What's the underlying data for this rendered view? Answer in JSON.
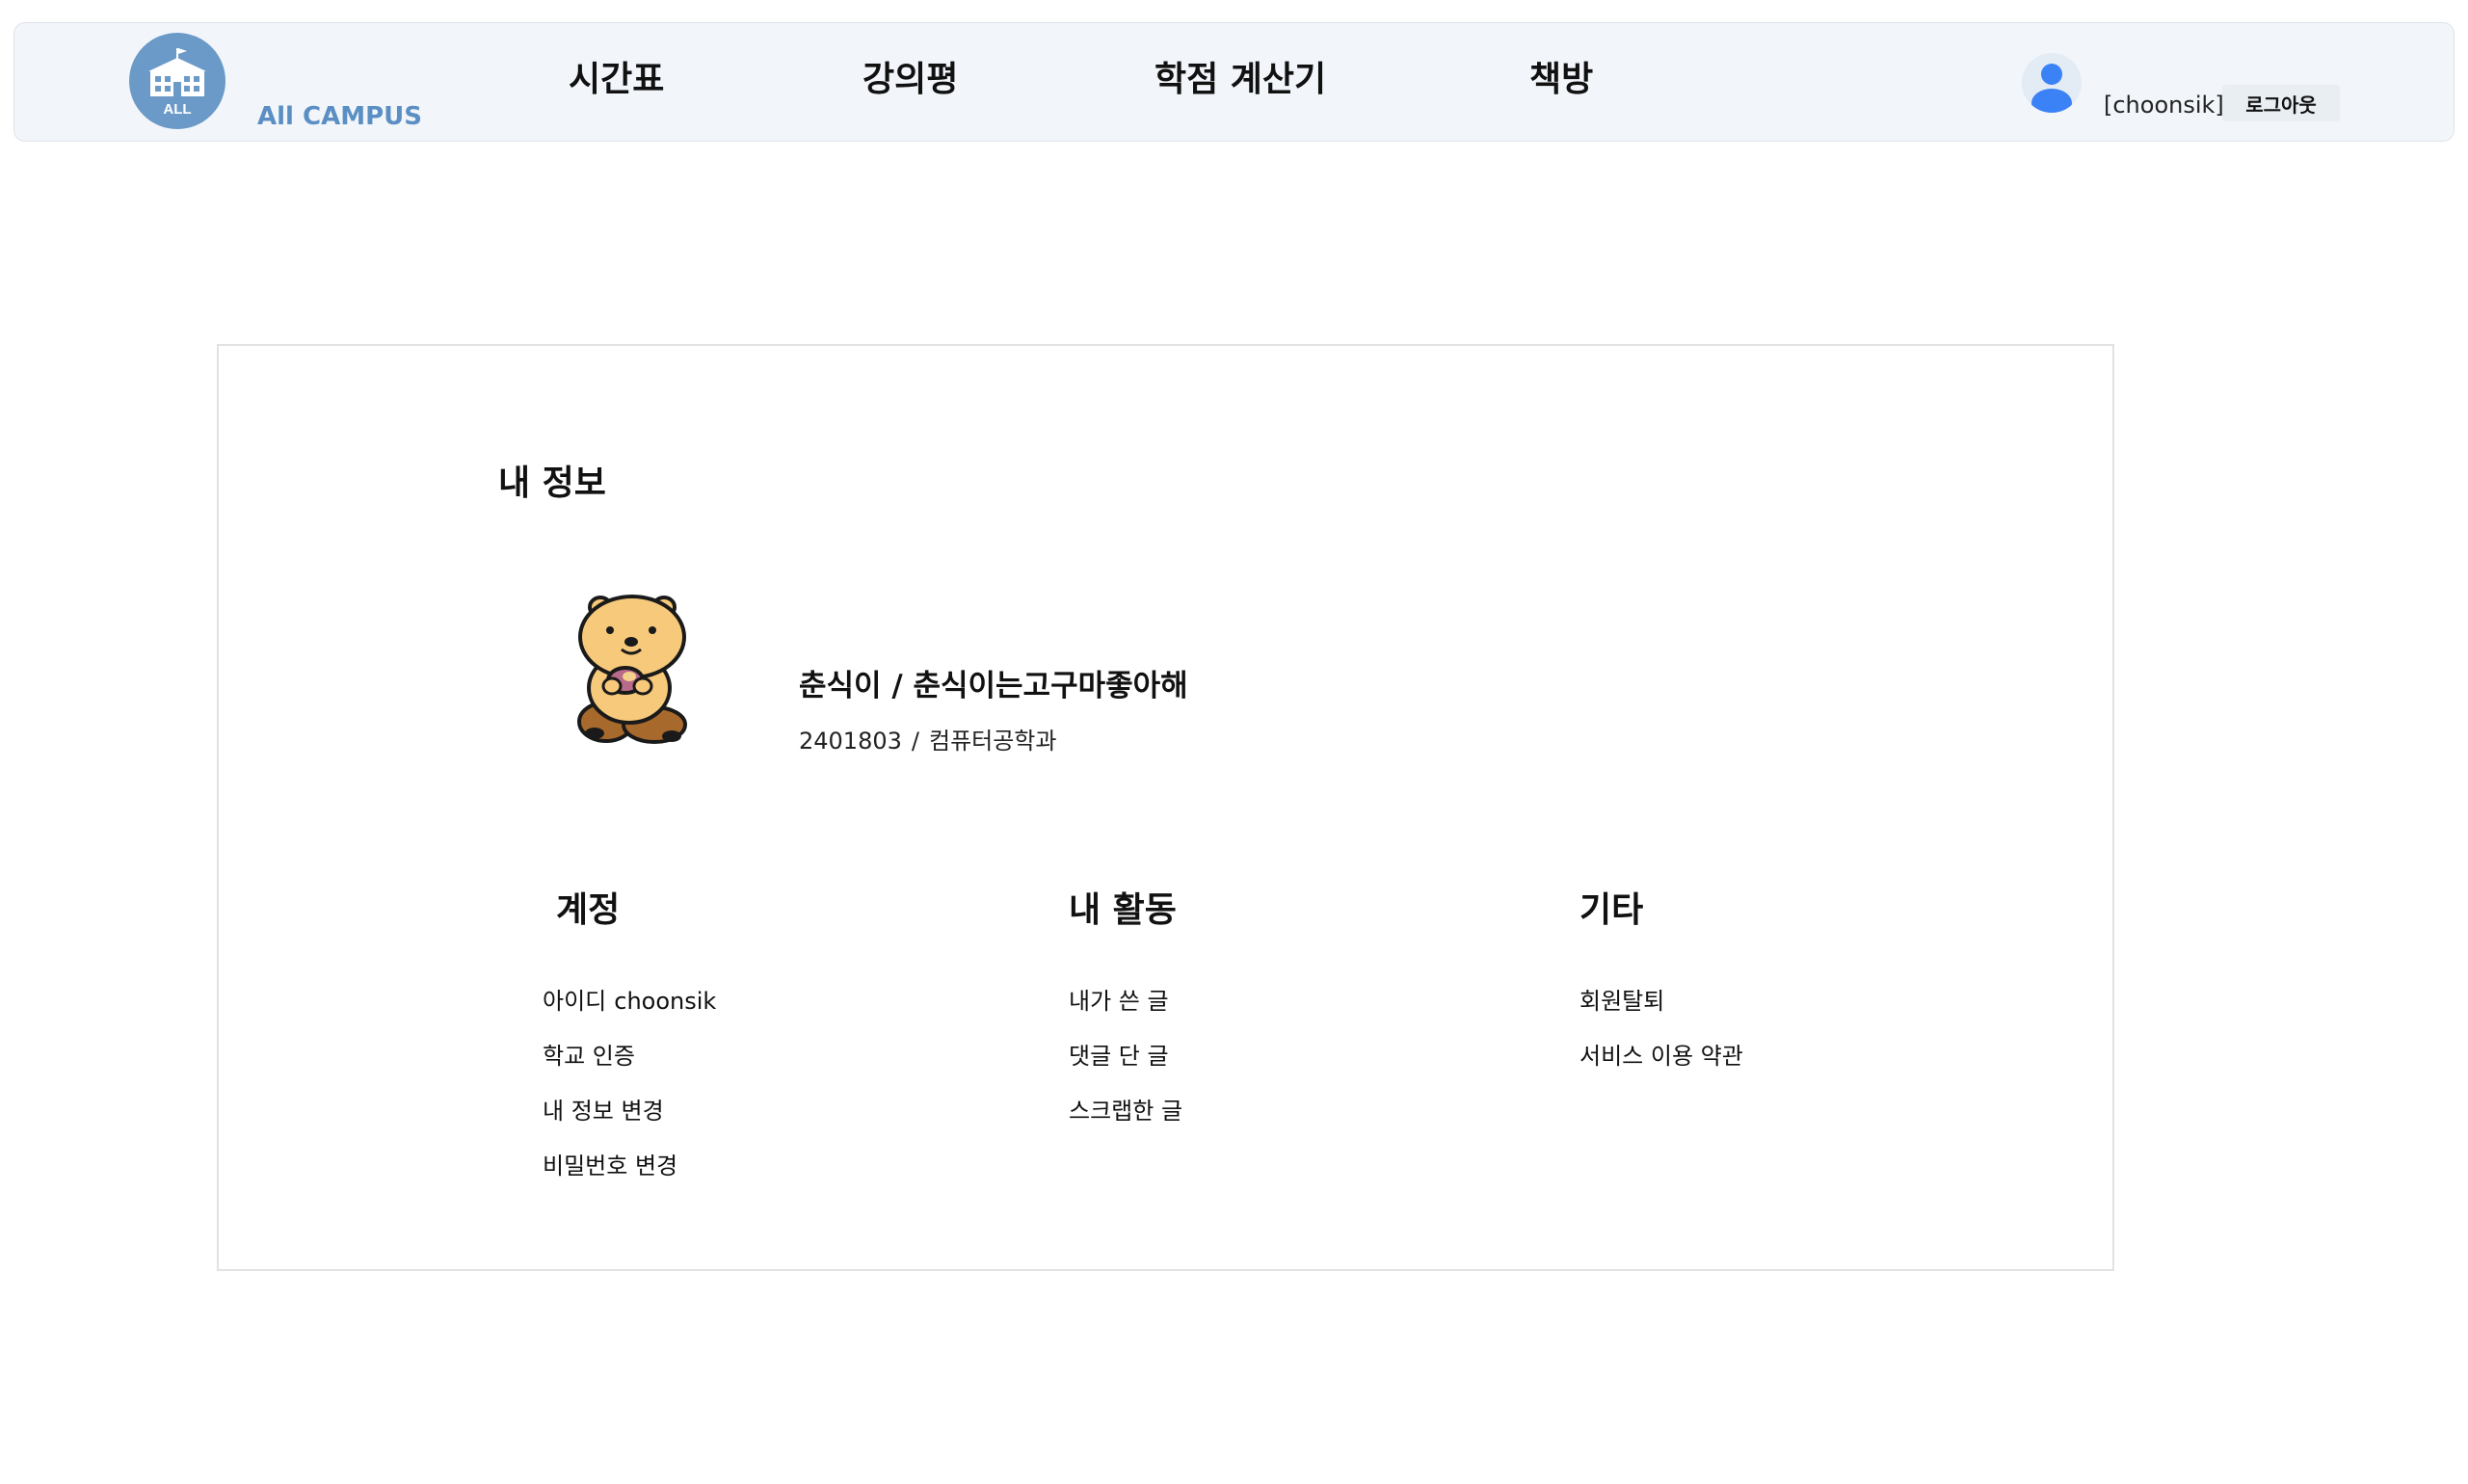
{
  "header": {
    "brand_name": "All CAMPUS",
    "logo_text": "ALL",
    "nav": {
      "timetable": "시간표",
      "reviews": "강의평",
      "gpa_calculator": "학점 계산기",
      "bookstore": "책방"
    },
    "user_name": "[choonsik]",
    "logout_label": "로그아웃",
    "accent_color": "#6b9ac9",
    "avatar_color": "#3b82f6"
  },
  "profile_section": {
    "title": "내 정보",
    "name_line": "춘식이 / 춘식이는고구마좋아해",
    "student_id": "2401803",
    "separator": "/",
    "department": "컴퓨터공학과",
    "image_icon": "character-illustration"
  },
  "columns": {
    "account": {
      "title": "계정",
      "items": [
        {
          "label": "아이디",
          "value": "choonsik"
        },
        {
          "label": "학교 인증"
        },
        {
          "label": "내 정보 변경"
        },
        {
          "label": "비밀번호 변경"
        }
      ]
    },
    "activity": {
      "title": "내 활동",
      "items": [
        {
          "label": "내가 쓴 글"
        },
        {
          "label": "댓글 단 글"
        },
        {
          "label": "스크랩한 글"
        }
      ]
    },
    "etc": {
      "title": "기타",
      "items": [
        {
          "label": "회원탈퇴"
        },
        {
          "label": "서비스 이용 약관"
        }
      ]
    }
  }
}
